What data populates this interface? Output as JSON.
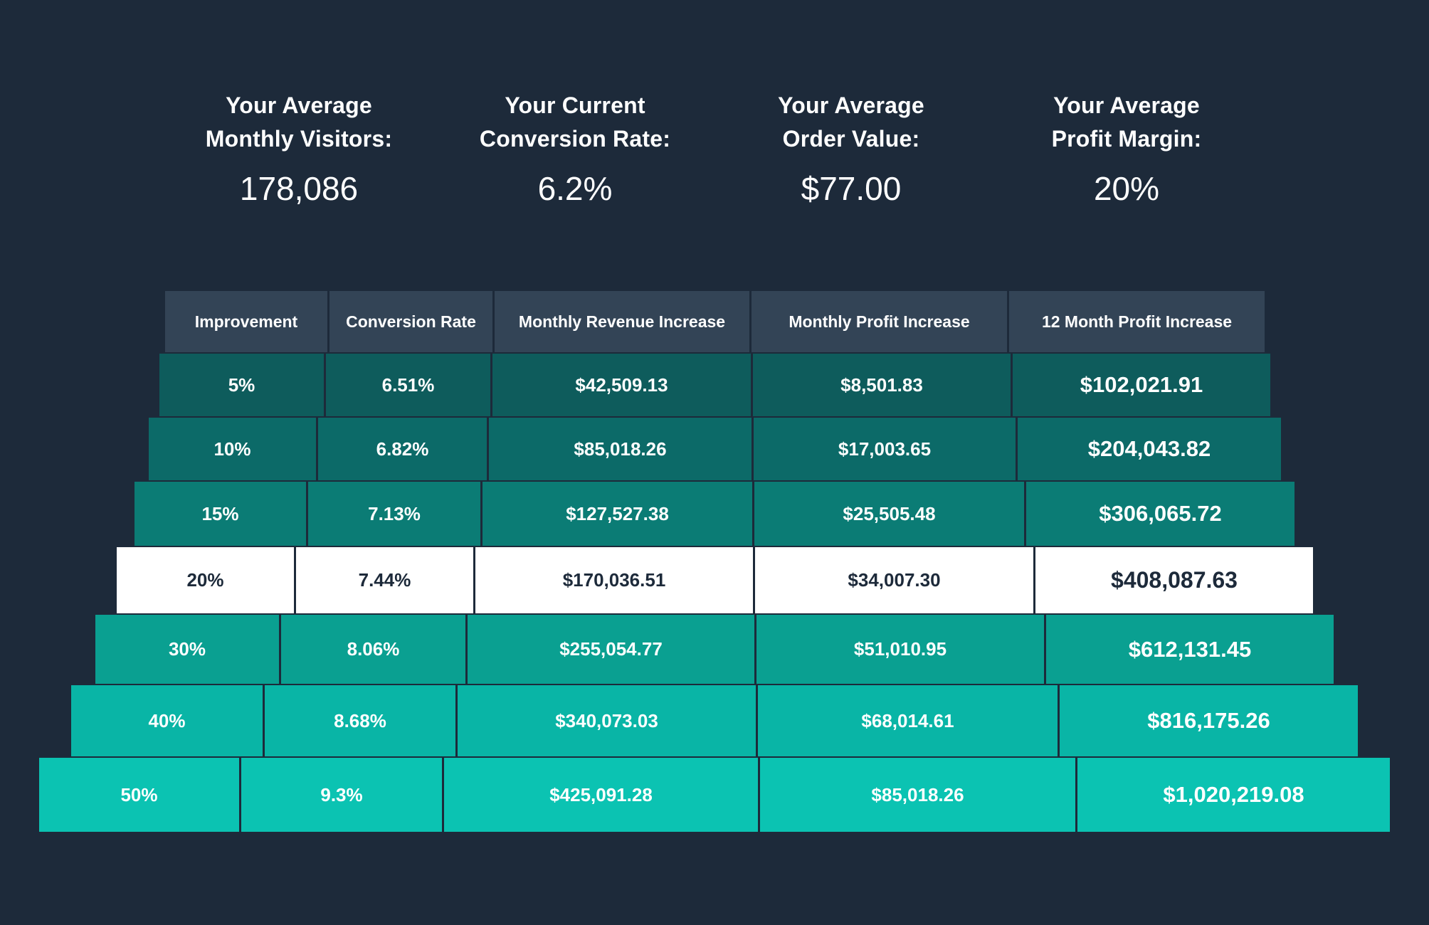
{
  "stats": [
    {
      "label_line1": "Your Average",
      "label_line2": "Monthly Visitors:",
      "value": "178,086"
    },
    {
      "label_line1": "Your Current",
      "label_line2": "Conversion Rate:",
      "value": "6.2%"
    },
    {
      "label_line1": "Your Average",
      "label_line2": "Order Value:",
      "value": "$77.00"
    },
    {
      "label_line1": "Your Average",
      "label_line2": "Profit Margin:",
      "value": "20%"
    }
  ],
  "table": {
    "headers": [
      "Improvement",
      "Conversion Rate",
      "Monthly Revenue Increase",
      "Monthly Profit Increase",
      "12 Month Profit Increase"
    ],
    "highlight_row_index": 3,
    "rows": [
      {
        "improvement": "5%",
        "conversion_rate": "6.51%",
        "monthly_revenue_increase": "$42,509.13",
        "monthly_profit_increase": "$8,501.83",
        "twelve_month_profit_increase": "$102,021.91"
      },
      {
        "improvement": "10%",
        "conversion_rate": "6.82%",
        "monthly_revenue_increase": "$85,018.26",
        "monthly_profit_increase": "$17,003.65",
        "twelve_month_profit_increase": "$204,043.82"
      },
      {
        "improvement": "15%",
        "conversion_rate": "7.13%",
        "monthly_revenue_increase": "$127,527.38",
        "monthly_profit_increase": "$25,505.48",
        "twelve_month_profit_increase": "$306,065.72"
      },
      {
        "improvement": "20%",
        "conversion_rate": "7.44%",
        "monthly_revenue_increase": "$170,036.51",
        "monthly_profit_increase": "$34,007.30",
        "twelve_month_profit_increase": "$408,087.63"
      },
      {
        "improvement": "30%",
        "conversion_rate": "8.06%",
        "monthly_revenue_increase": "$255,054.77",
        "monthly_profit_increase": "$51,010.95",
        "twelve_month_profit_increase": "$612,131.45"
      },
      {
        "improvement": "40%",
        "conversion_rate": "8.68%",
        "monthly_revenue_increase": "$340,073.03",
        "monthly_profit_increase": "$68,014.61",
        "twelve_month_profit_increase": "$816,175.26"
      },
      {
        "improvement": "50%",
        "conversion_rate": "9.3%",
        "monthly_revenue_increase": "$425,091.28",
        "monthly_profit_increase": "$85,018.26",
        "twelve_month_profit_increase": "$1,020,219.08"
      }
    ]
  },
  "colors": {
    "background": "#1d2a3a",
    "header": "#334456",
    "highlight": "#ffffff",
    "highlight_text": "#1d2a3a",
    "row_fills": [
      "#0e5c5c",
      "#0c6a68",
      "#0b7c75",
      "#ffffff",
      "#0aa091",
      "#09b5a6",
      "#0bc3b2"
    ]
  }
}
